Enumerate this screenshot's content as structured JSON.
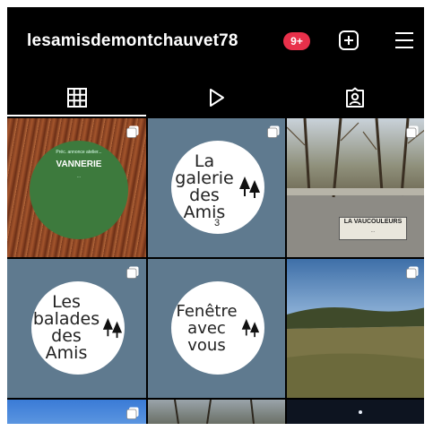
{
  "header": {
    "username": "lesamisdemontchauvet78",
    "notification_badge": "9+",
    "new_post_icon": "plus-square-icon",
    "menu_icon": "hamburger-menu-icon"
  },
  "tabs": [
    {
      "name": "grid",
      "icon": "grid-icon",
      "active": true
    },
    {
      "name": "reels",
      "icon": "play-icon",
      "active": false
    },
    {
      "name": "tagged",
      "icon": "tagged-person-icon",
      "active": false
    }
  ],
  "posts": {
    "vannerie": {
      "small_top": "Préc. annonce atelier...",
      "title": "VANNERIE",
      "small_bottom": "...",
      "multi": true
    },
    "galerie": {
      "line1": "La",
      "line2": "galerie",
      "line3": "des",
      "line4": "Amis",
      "number": "3",
      "multi": true
    },
    "sign": {
      "title": "LA VAUCOULEURS",
      "subtitle": "...",
      "multi": true
    },
    "balades": {
      "line1": "Les",
      "line2": "balades",
      "line3": "des",
      "line4": "Amis",
      "multi": true
    },
    "fenetre": {
      "line1": "Fenêtre",
      "line2": "avec",
      "line3": "vous",
      "multi": false
    },
    "landscape": {
      "multi": true
    }
  },
  "colors": {
    "background": "#000000",
    "tile_blue": "#5f7a8f",
    "badge_red": "#e8304a",
    "green_circle": "#3d7a3d"
  }
}
